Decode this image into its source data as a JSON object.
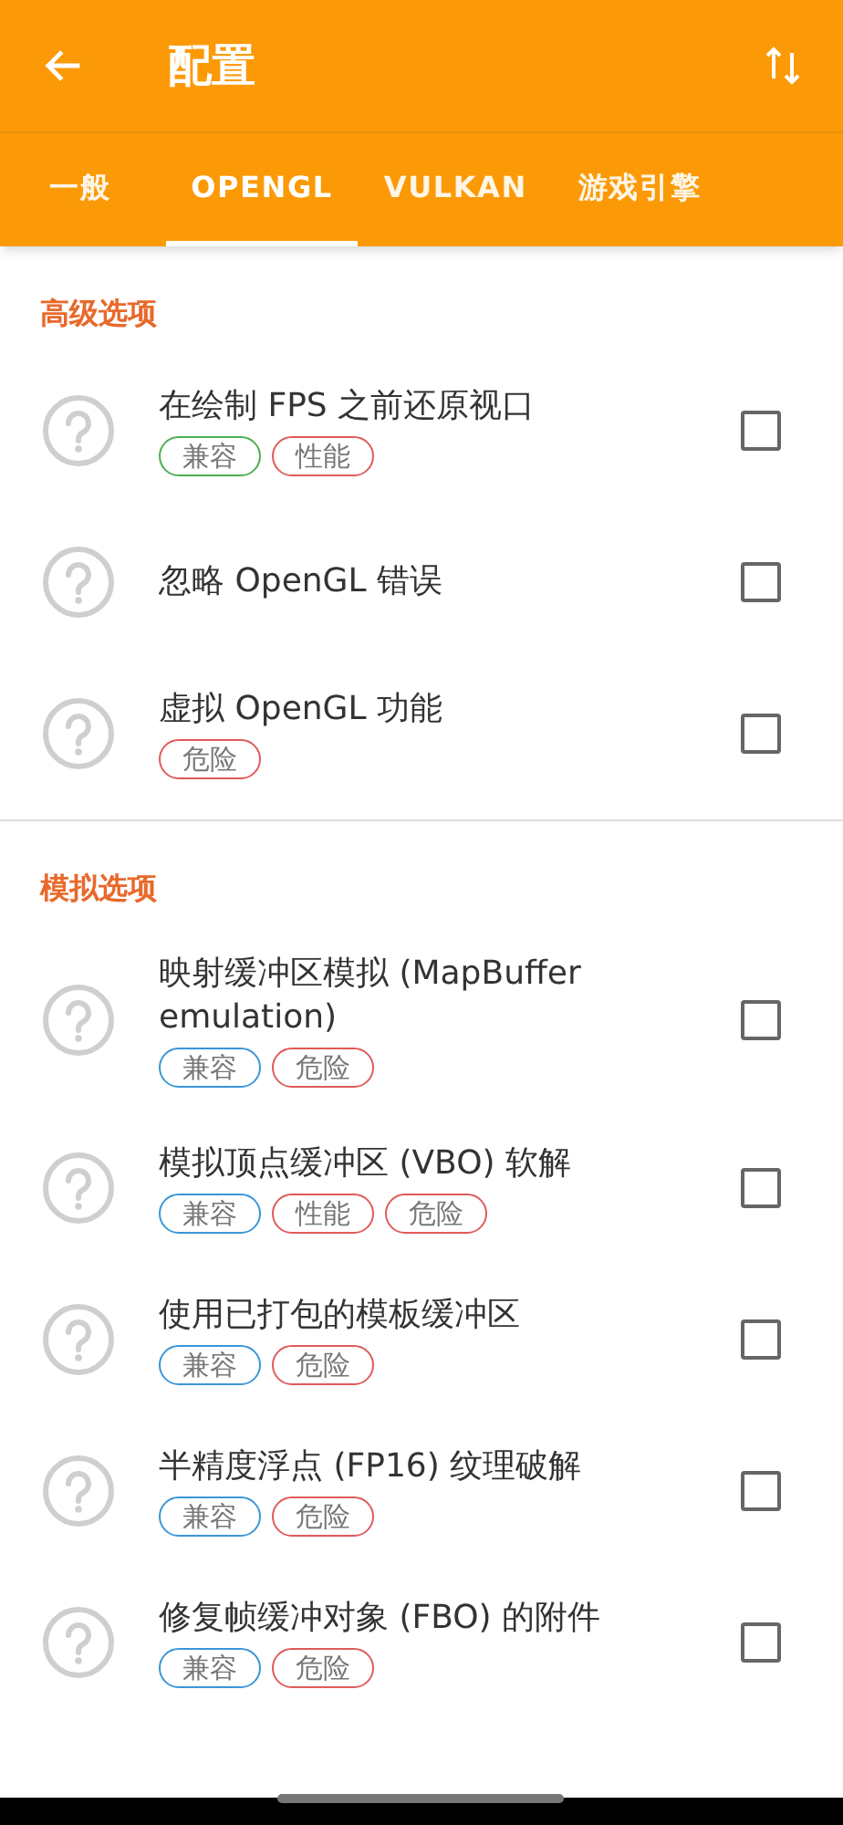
{
  "app_bar": {
    "title": "配置"
  },
  "tabs": [
    {
      "label": "一般",
      "selected": false
    },
    {
      "label": "OPENGL",
      "selected": true
    },
    {
      "label": "VULKAN",
      "selected": false
    },
    {
      "label": "游戏引擎",
      "selected": false
    }
  ],
  "sections": [
    {
      "title": "高级选项",
      "options": [
        {
          "label": "在绘制 FPS 之前还原视口",
          "checked": false,
          "tags": [
            {
              "label": "兼容",
              "color": "#4caf50"
            },
            {
              "label": "性能",
              "color": "#e05a5a"
            }
          ]
        },
        {
          "label": "忽略 OpenGL 错误",
          "checked": false
        },
        {
          "label": "虚拟 OpenGL 功能",
          "checked": false,
          "tags": [
            {
              "label": "危险",
              "color": "#e05a5a"
            }
          ]
        }
      ]
    },
    {
      "title": "模拟选项",
      "options": [
        {
          "label": "映射缓冲区模拟 (MapBuffer emulation)",
          "checked": false,
          "tags": [
            {
              "label": "兼容",
              "color": "#3a96d8"
            },
            {
              "label": "危险",
              "color": "#e05a5a"
            }
          ]
        },
        {
          "label": "模拟顶点缓冲区 (VBO) 软解",
          "checked": false,
          "tags": [
            {
              "label": "兼容",
              "color": "#3a96d8"
            },
            {
              "label": "性能",
              "color": "#e05a5a"
            },
            {
              "label": "危险",
              "color": "#e05a5a"
            }
          ]
        },
        {
          "label": "使用已打包的模板缓冲区",
          "checked": false,
          "tags": [
            {
              "label": "兼容",
              "color": "#3a96d8"
            },
            {
              "label": "危险",
              "color": "#e05a5a"
            }
          ]
        },
        {
          "label": "半精度浮点 (FP16) 纹理破解",
          "checked": false,
          "tags": [
            {
              "label": "兼容",
              "color": "#3a96d8"
            },
            {
              "label": "危险",
              "color": "#e05a5a"
            }
          ]
        },
        {
          "label": "修复帧缓冲对象 (FBO) 的附件",
          "checked": false,
          "tags": [
            {
              "label": "兼容",
              "color": "#3a96d8"
            },
            {
              "label": "危险",
              "color": "#e05a5a"
            }
          ]
        }
      ]
    }
  ]
}
